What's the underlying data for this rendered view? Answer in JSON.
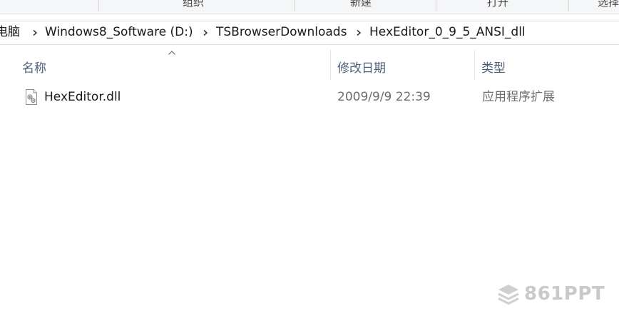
{
  "ribbon": {
    "groups": [
      "组织",
      "新建",
      "打开",
      "选择"
    ]
  },
  "address_bar": {
    "crumbs": [
      "电脑",
      "Windows8_Software (D:)",
      "TSBrowserDownloads",
      "HexEditor_0_9_5_ANSI_dll"
    ]
  },
  "columns": {
    "name": "名称",
    "date_modified": "修改日期",
    "type": "类型",
    "sort_indicator": "chevron-up-icon"
  },
  "files": [
    {
      "name": "HexEditor.dll",
      "date_modified": "2009/9/9 22:39",
      "type": "应用程序扩展",
      "icon": "dll-file-icon"
    }
  ],
  "watermark": {
    "text": "861PPT"
  },
  "colors": {
    "header_text": "#4c607a",
    "secondary_text": "#6d6d6d",
    "watermark": "#c9c9c9"
  }
}
